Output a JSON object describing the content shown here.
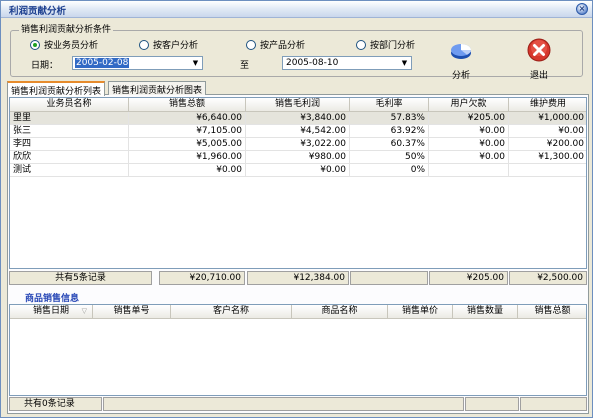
{
  "window": {
    "title": "利润贡献分析",
    "close_glyph": "×"
  },
  "conditions": {
    "legend": "销售利润贡献分析条件",
    "radios": [
      {
        "label": "按业务员分析",
        "checked": true
      },
      {
        "label": "按客户分析",
        "checked": false
      },
      {
        "label": "按产品分析",
        "checked": false
      },
      {
        "label": "按部门分析",
        "checked": false
      }
    ],
    "date_label": "日期：",
    "date_from": "2005-02-08",
    "to_label": "至",
    "date_to": "2005-08-10",
    "dropdown_glyph": "▼",
    "analyze_label": "分析",
    "exit_label": "退出"
  },
  "tabs": [
    {
      "label": "销售利润贡献分析列表",
      "active": true
    },
    {
      "label": "销售利润贡献分析图表",
      "active": false
    }
  ],
  "main_table": {
    "columns": [
      "业务员名称",
      "销售总额",
      "销售毛利润",
      "毛利率",
      "用户欠款",
      "维护费用"
    ],
    "rows": [
      [
        "里里",
        "¥6,640.00",
        "¥3,840.00",
        "57.83%",
        "¥205.00",
        "¥1,000.00"
      ],
      [
        "张三",
        "¥7,105.00",
        "¥4,542.00",
        "63.92%",
        "¥0.00",
        "¥0.00"
      ],
      [
        "李四",
        "¥5,005.00",
        "¥3,022.00",
        "60.37%",
        "¥0.00",
        "¥200.00"
      ],
      [
        "欣欣",
        "¥1,960.00",
        "¥980.00",
        "50%",
        "¥0.00",
        "¥1,300.00"
      ],
      [
        "测试",
        "¥0.00",
        "¥0.00",
        "0%",
        "",
        ""
      ]
    ],
    "summary": {
      "count": "共有5条记录",
      "total_sales": "¥20,710.00",
      "total_profit": "¥12,384.00",
      "total_debt": "¥205.00",
      "total_fee": "¥2,500.00"
    }
  },
  "sales_info": {
    "title": "商品销售信息",
    "columns": [
      "销售日期",
      "销售单号",
      "客户名称",
      "商品名称",
      "销售单价",
      "销售数量",
      "销售总额"
    ],
    "status": "共有0条记录"
  }
}
